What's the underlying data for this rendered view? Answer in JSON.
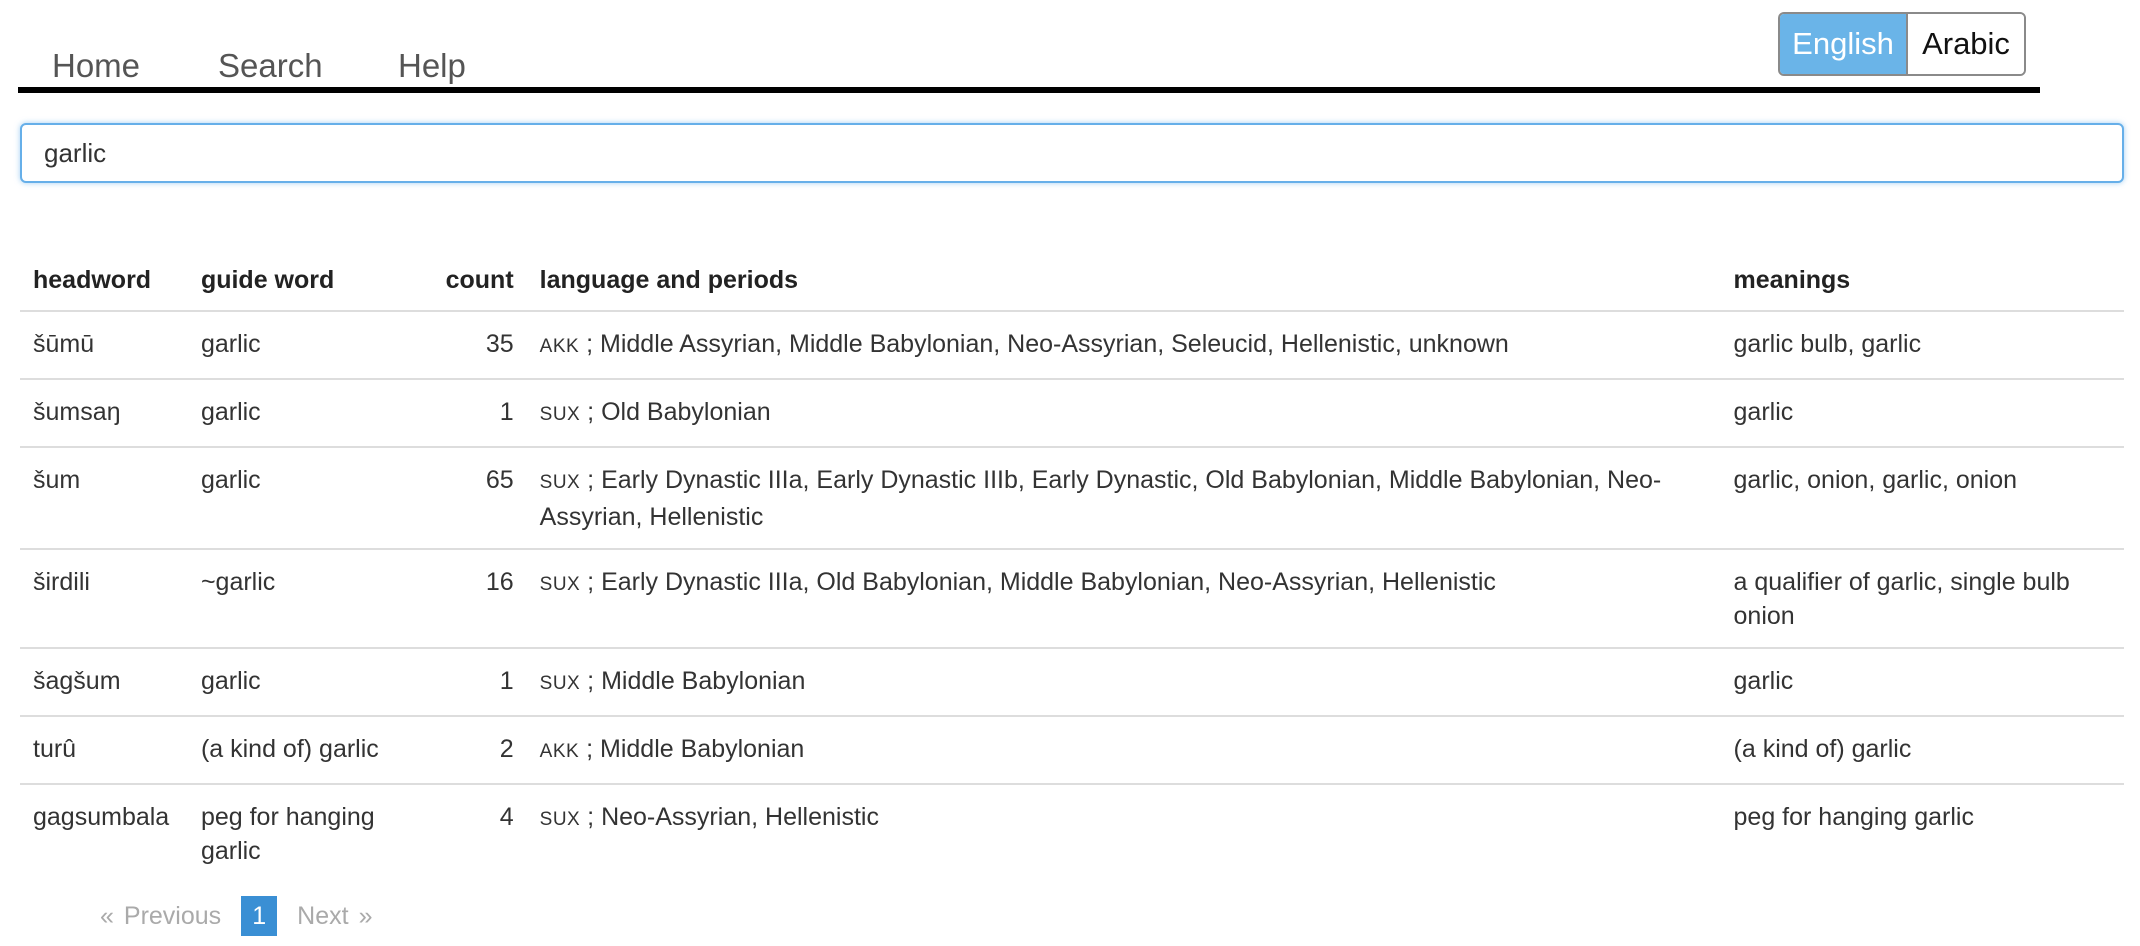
{
  "nav": {
    "home": "Home",
    "search": "Search",
    "help": "Help"
  },
  "language_toggle": {
    "english": "English",
    "arabic": "Arabic",
    "active": "English",
    "active_color": "#6ab4e8"
  },
  "search": {
    "value": "garlic"
  },
  "table": {
    "headers": {
      "headword": "headword",
      "guide_word": "guide word",
      "count": "count",
      "language_and_periods": "language and periods",
      "meanings": "meanings"
    },
    "rows": [
      {
        "headword": "šūmū",
        "guide_word": "garlic",
        "count": "35",
        "lang": "AKK",
        "periods": " ; Middle Assyrian, Middle Babylonian, Neo-Assyrian, Seleucid, Hellenistic, unknown",
        "meanings": "garlic bulb, garlic"
      },
      {
        "headword": "šumsaŋ",
        "guide_word": "garlic",
        "count": "1",
        "lang": "SUX",
        "periods": " ; Old Babylonian",
        "meanings": "garlic"
      },
      {
        "headword": "šum",
        "guide_word": "garlic",
        "count": "65",
        "lang": "SUX",
        "periods": " ; Early Dynastic IIIa, Early Dynastic IIIb, Early Dynastic, Old Babylonian, Middle Babylonian, Neo-Assyrian, Hellenistic",
        "meanings": "garlic, onion, garlic, onion"
      },
      {
        "headword": "širdili",
        "guide_word": "~garlic",
        "count": "16",
        "lang": "SUX",
        "periods": " ; Early Dynastic IIIa, Old Babylonian, Middle Babylonian, Neo-Assyrian, Hellenistic",
        "meanings": "a qualifier of garlic, single bulb onion"
      },
      {
        "headword": "šagšum",
        "guide_word": "garlic",
        "count": "1",
        "lang": "SUX",
        "periods": " ; Middle Babylonian",
        "meanings": "garlic"
      },
      {
        "headword": "turû",
        "guide_word": "(a kind of) garlic",
        "count": "2",
        "lang": "AKK",
        "periods": " ; Middle Babylonian",
        "meanings": "(a kind of) garlic"
      },
      {
        "headword": "gagsumbala",
        "guide_word": "peg for hanging garlic",
        "count": "4",
        "lang": "SUX",
        "periods": " ; Neo-Assyrian, Hellenistic",
        "meanings": "peg for hanging garlic"
      }
    ]
  },
  "pagination": {
    "prev_arrow": "«",
    "previous": "Previous",
    "current_page": "1",
    "next": "Next",
    "next_arrow": "»",
    "current_color": "#3a8fd4"
  }
}
